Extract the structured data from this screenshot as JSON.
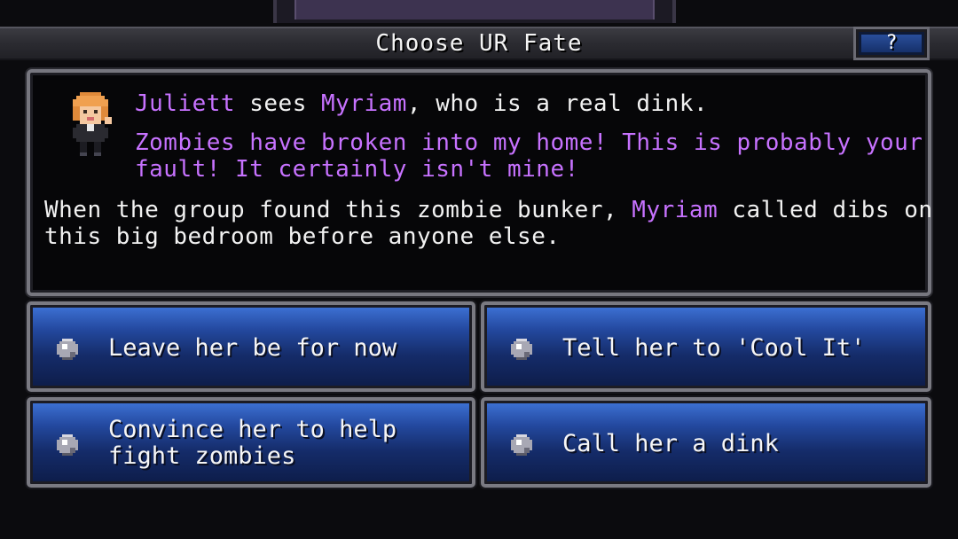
{
  "title": "Choose UR Fate",
  "help_label": "?",
  "message": {
    "line1": {
      "speaker": "Juliett",
      "mid": " sees ",
      "target": "Myriam",
      "rest": ", who is a real dink."
    },
    "quote_line1": "Zombies have broken into my home! This is probably your",
    "quote_line2": "fault! It certainly isn't mine!",
    "narration_line1_pre": "When the group found this zombie bunker, ",
    "narration_line1_name": "Myriam",
    "narration_line1_post": " called dibs on",
    "narration_line2": "this big bedroom before anyone else."
  },
  "choices": [
    {
      "lines": [
        "Leave her be for now"
      ]
    },
    {
      "lines": [
        "Tell her to 'Cool It'"
      ]
    },
    {
      "lines": [
        "Convince her to help",
        "fight zombies"
      ]
    },
    {
      "lines": [
        "Call her a dink"
      ]
    }
  ],
  "colors": {
    "highlight_purple": "#c772ff",
    "button_blue": "#23489e",
    "frame_gray": "#77777f"
  }
}
